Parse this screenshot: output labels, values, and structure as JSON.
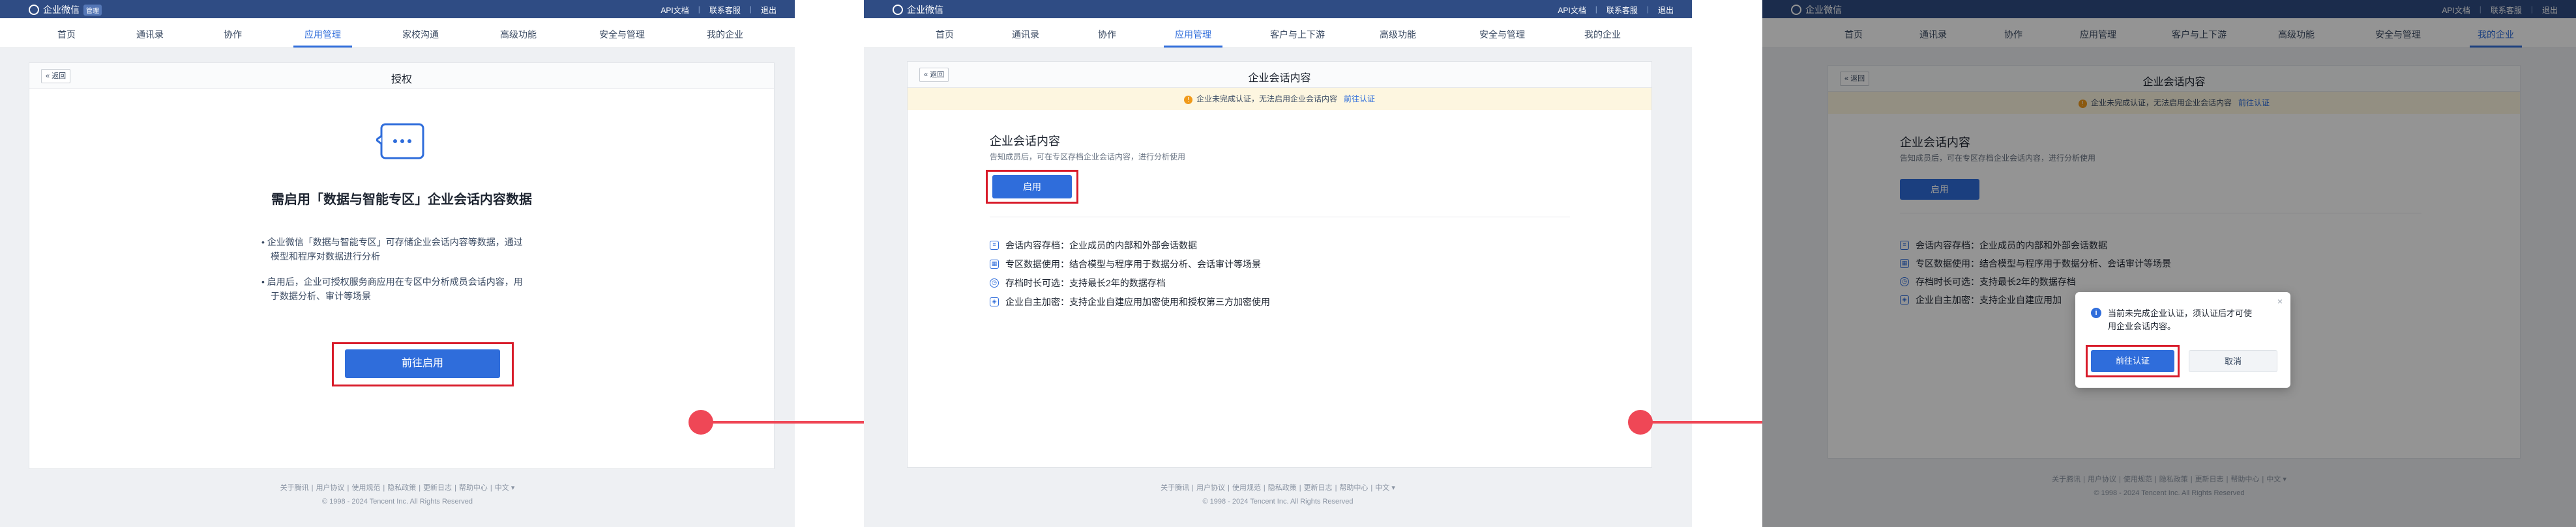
{
  "app": {
    "name": "企业微信",
    "badge": "管理"
  },
  "toplinks": [
    "API文档",
    "联系客服",
    "退出"
  ],
  "nav1": [
    "首页",
    "通讯录",
    "协作",
    "应用管理",
    "家校沟通",
    "高级功能",
    "安全与管理",
    "我的企业"
  ],
  "nav2": [
    "首页",
    "通讯录",
    "协作",
    "应用管理",
    "客户与上下游",
    "高级功能",
    "安全与管理",
    "我的企业"
  ],
  "back_label": "返回",
  "panel1": {
    "title": "授权",
    "heading": "需启用「数据与智能专区」企业会话内容数据",
    "bullet1a": "企业微信「数据与智能专区」可存储企业会话内容等数据，通过",
    "bullet1b": "模型和程序对数据进行分析",
    "bullet2a": "启用后，企业可授权服务商应用在专区中分析成员会话内容，用",
    "bullet2b": "于数据分析、审计等场景",
    "button": "前往启用"
  },
  "panel2": {
    "title": "企业会话内容",
    "warning": "企业未完成认证，无法启用企业会话内容",
    "warning_link": "前往认证",
    "section_title": "企业会话内容",
    "section_desc": "告知成员后，可在专区存档企业会话内容，进行分析使用",
    "button": "启用",
    "features": [
      "会话内容存档：企业成员的内部和外部会话数据",
      "专区数据使用：结合模型与程序用于数据分析、会话审计等场景",
      "存档时长可选：支持最长2年的数据存档",
      "企业自主加密：支持企业自建应用加密使用和授权第三方加密使用"
    ]
  },
  "panel3": {
    "title": "企业会话内容",
    "warning": "企业未完成认证，无法启用企业会话内容",
    "warning_link": "前往认证",
    "section_title": "企业会话内容",
    "section_desc": "告知成员后，可在专区存档企业会话内容，进行分析使用",
    "button": "启用",
    "features": [
      "会话内容存档：企业成员的内部和外部会话数据",
      "专区数据使用：结合模型与程序用于数据分析、会话审计等场景",
      "存档时长可选：支持最长2年的数据存档",
      "企业自主加密：支持企业自建应用加"
    ],
    "dialog_msg_a": "当前未完成企业认证，须认证后才可使",
    "dialog_msg_b": "用企业会话内容。",
    "dialog_confirm": "前往认证",
    "dialog_cancel": "取消"
  },
  "footer": {
    "links": [
      "关于腾讯",
      "用户协议",
      "使用规范",
      "隐私政策",
      "更新日志",
      "帮助中心",
      "中文 ▾"
    ],
    "copyright": "© 1998 - 2024 Tencent Inc. All Rights Reserved"
  },
  "colors": {
    "accent": "#2f6ddb",
    "topbar": "#2f4c84",
    "highlight": "#d81b2a",
    "arrow": "#ef4756"
  }
}
